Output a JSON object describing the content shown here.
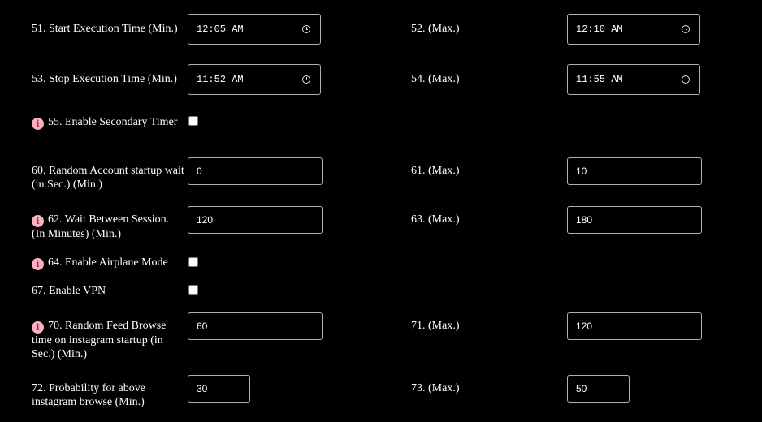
{
  "rows": {
    "start_exec": {
      "label": "51. Start Execution Time (Min.)",
      "value": "12:05 AM",
      "max_label": "52. (Max.)",
      "max_value": "12:10 AM"
    },
    "stop_exec": {
      "label": "53. Stop Execution Time (Min.)",
      "value": "11:52 AM",
      "max_label": "54. (Max.)",
      "max_value": "11:55 AM"
    },
    "secondary_timer": {
      "label": "55. Enable Secondary Timer"
    },
    "account_wait": {
      "label": "60. Random Account startup wait (in Sec.) (Min.)",
      "value": "0",
      "max_label": "61. (Max.)",
      "max_value": "10"
    },
    "session_wait": {
      "label": "62. Wait Between Session. (In Minutes) (Min.)",
      "value": "120",
      "max_label": "63. (Max.)",
      "max_value": "180"
    },
    "airplane": {
      "label": "64. Enable Airplane Mode"
    },
    "vpn": {
      "label": "67. Enable VPN"
    },
    "feed_browse": {
      "label": "70. Random Feed Browse time on instagram startup (in Sec.) (Min.)",
      "value": "60",
      "max_label": "71. (Max.)",
      "max_value": "120"
    },
    "probability": {
      "label": "72. Probability for above instagram browse (Min.)",
      "value": "30",
      "max_label": "73. (Max.)",
      "max_value": "50"
    }
  },
  "info_glyph": "i",
  "colors": {
    "background": "#000000",
    "text": "#ffffff",
    "info_badge": "#f7b3bd",
    "input_border": "#b0b0b0"
  },
  "icons": {
    "time": "clock-icon",
    "info": "info-icon"
  }
}
